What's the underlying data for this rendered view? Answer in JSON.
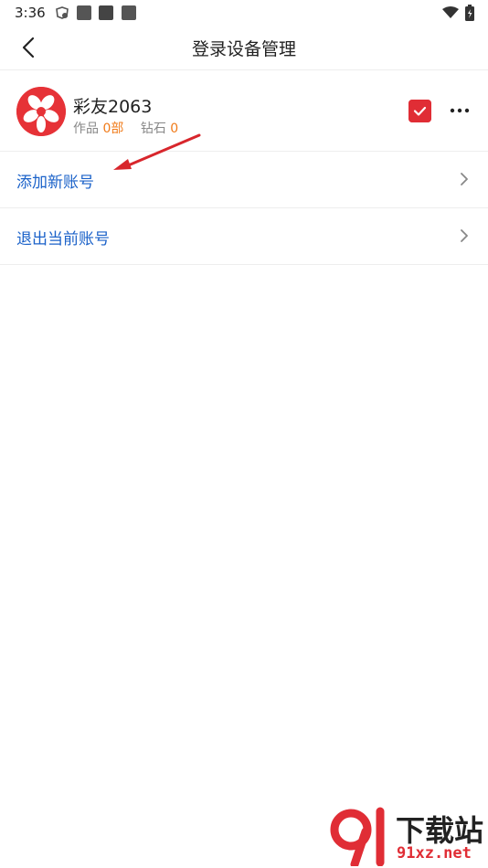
{
  "status_bar": {
    "time": "3:36"
  },
  "header": {
    "title": "登录设备管理"
  },
  "account": {
    "name": "彩友2063",
    "works_label": "作品",
    "works_value": "0部",
    "diamond_label": "钻石",
    "diamond_value": "0"
  },
  "menu": [
    {
      "label": "添加新账号"
    },
    {
      "label": "退出当前账号"
    }
  ],
  "colors": {
    "accent_red": "#e02d35",
    "link_blue": "#1b62c9",
    "stat_orange": "#f07b1a"
  },
  "watermark": {
    "title": "下载站",
    "site": "91xz.net"
  }
}
